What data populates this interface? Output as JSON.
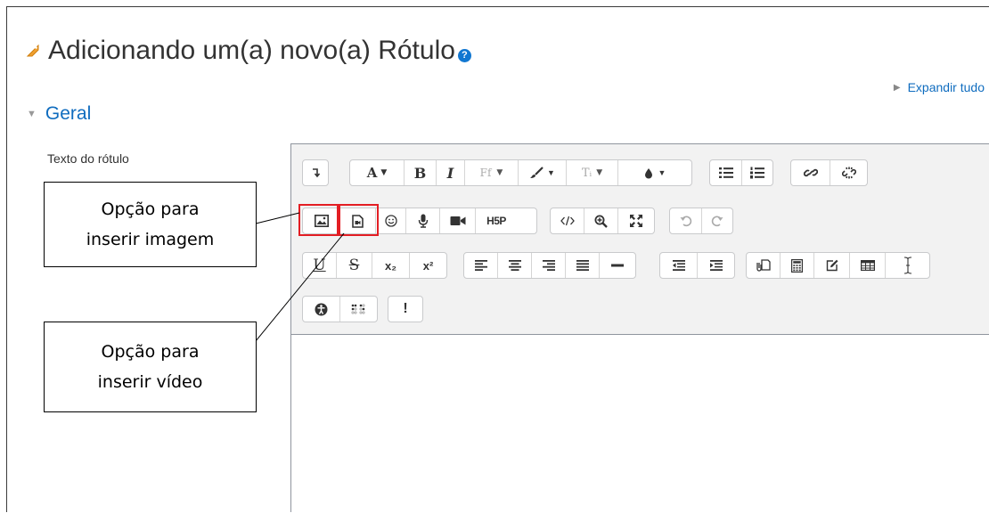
{
  "page": {
    "title": "Adicionando um(a) novo(a) Rótulo",
    "title_icon": "tag-icon",
    "help_icon": "question-icon",
    "help_glyph": "?",
    "expand_all": "Expandir tudo",
    "section": "Geral",
    "field_label": "Texto do rótulo"
  },
  "toolbar": {
    "font_color_glyph": "A",
    "bold_glyph": "B",
    "italic_glyph": "I",
    "font_family_glyph": "Ff",
    "text_style_glyph": "Tᵢ",
    "underline_glyph": "U",
    "strike_glyph": "S",
    "subscript_glyph": "x₂",
    "superscript_glyph": "x²",
    "h5p_glyph": "H5P",
    "accessibility_glyph": "!",
    "buttons": [
      "collapse-toolbar",
      "font-color",
      "bold",
      "italic",
      "font-family",
      "brush",
      "text-style",
      "text-color",
      "bullet-list",
      "numbered-list",
      "link",
      "unlink",
      "image",
      "media",
      "emoji",
      "record-audio",
      "record-video",
      "h5p",
      "html",
      "find-replace",
      "fullscreen",
      "undo",
      "redo",
      "underline",
      "strikethrough",
      "subscript",
      "superscript",
      "align-left",
      "align-center",
      "align-right",
      "align-justify",
      "horizontal-rule",
      "outdent",
      "indent",
      "paste-special",
      "calculator",
      "edit",
      "table",
      "clear-formatting",
      "accessibility-checker",
      "screen-reader",
      "accessibility-alert"
    ]
  },
  "annotations": {
    "image_callout": [
      "Opção para",
      "inserir imagem"
    ],
    "video_callout": [
      "Opção para",
      "inserir vídeo"
    ]
  },
  "colors": {
    "link": "#0f6cbf",
    "highlight": "#e31e24",
    "toolbar_bg": "#f2f2f2",
    "help_badge": "#1177d1"
  }
}
